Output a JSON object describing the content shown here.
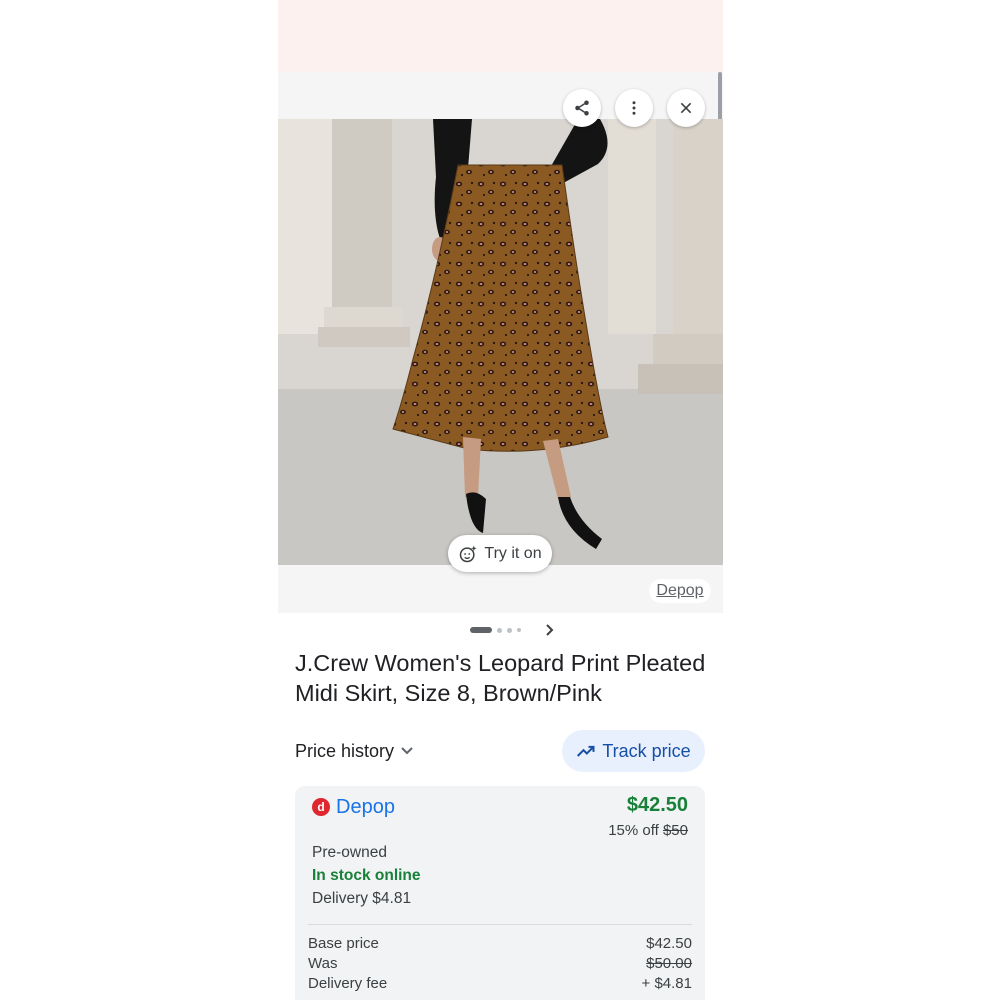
{
  "toolbar": {
    "share_icon": "share-icon",
    "more_icon": "more-vert-icon",
    "close_icon": "close-icon"
  },
  "image": {
    "try_on_label": "Try it on",
    "source_label": "Depop",
    "carousel": {
      "dot_count": 4,
      "active_index": 0
    }
  },
  "product": {
    "title": "J.Crew Women's Leopard Print Pleated Midi Skirt, Size 8, Brown/Pink"
  },
  "actions": {
    "price_history_label": "Price history",
    "track_price_label": "Track price"
  },
  "offer": {
    "seller": "Depop",
    "price": "$42.50",
    "discount_text": "15% off",
    "original_price": "$50",
    "condition": "Pre-owned",
    "stock": "In stock online",
    "delivery": "Delivery $4.81",
    "breakdown": [
      {
        "label": "Base price",
        "value": "$42.50",
        "strike": false
      },
      {
        "label": "Was",
        "value": "$50.00",
        "strike": true
      },
      {
        "label": "Delivery fee",
        "value": "+ $4.81",
        "strike": false
      }
    ]
  },
  "colors": {
    "accent_blue": "#1a73e8",
    "price_green": "#188038",
    "track_bg": "#e8f0fe",
    "depop_red": "#e0262f"
  }
}
